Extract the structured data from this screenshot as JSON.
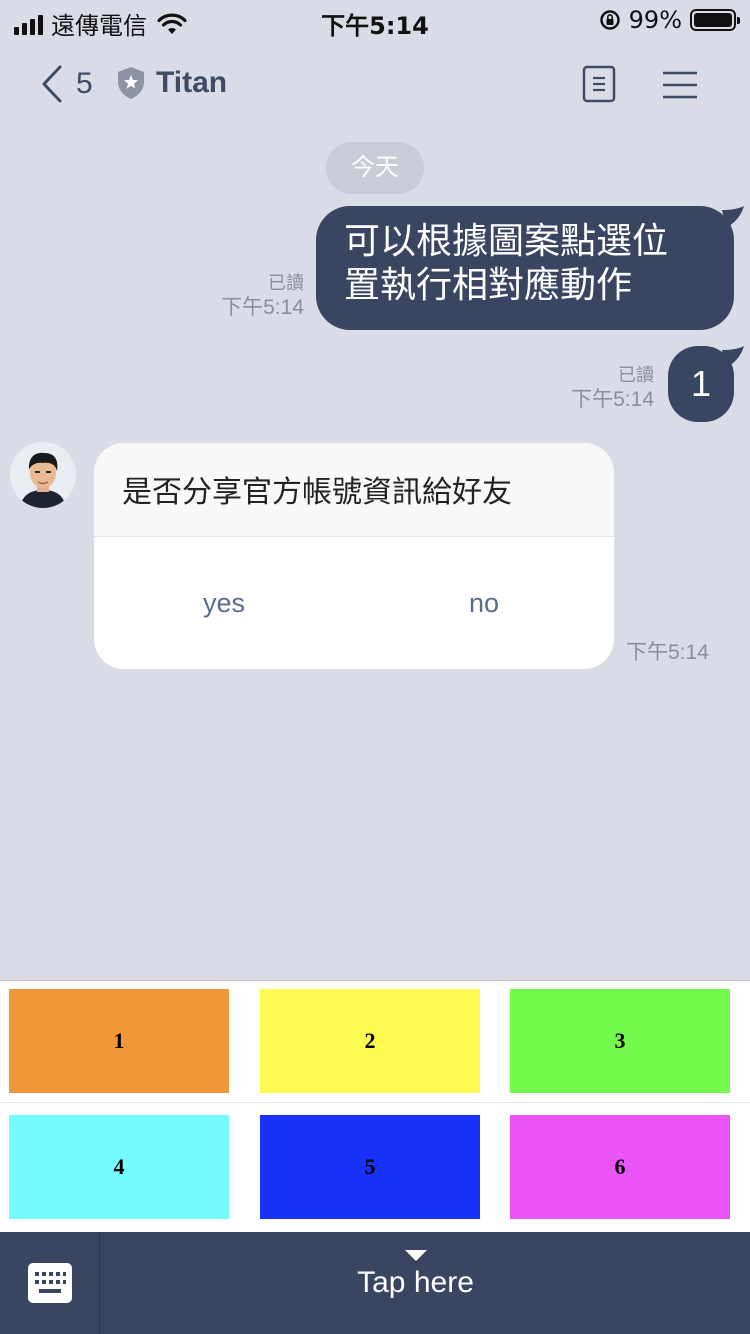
{
  "status_bar": {
    "carrier": "遠傳電信",
    "time": "下午5:14",
    "battery_percent": "99%",
    "battery_level": 0.99
  },
  "nav": {
    "unread_count": "5",
    "title": "Titan",
    "icons": [
      "chevron-left-icon",
      "shield-star-icon",
      "note-icon",
      "menu-icon"
    ]
  },
  "chat": {
    "date_label": "今天",
    "messages": [
      {
        "direction": "out",
        "text": "可以根據圖案點選位置執行相對應動作",
        "line1": "可以根據圖案點選位",
        "line2": "置執行相對應動作",
        "read_label": "已讀",
        "time": "下午5:14"
      },
      {
        "direction": "out",
        "text": "1",
        "read_label": "已讀",
        "time": "下午5:14"
      },
      {
        "direction": "in",
        "type": "confirm",
        "text": "是否分享官方帳號資訊給好友",
        "actions": [
          "yes",
          "no"
        ],
        "time": "下午5:14"
      }
    ]
  },
  "rich_menu": {
    "cells": [
      {
        "label": "1",
        "color": "#f0973a"
      },
      {
        "label": "2",
        "color": "#fdfb51"
      },
      {
        "label": "3",
        "color": "#73fa4c"
      },
      {
        "label": "4",
        "color": "#73fbfd"
      },
      {
        "label": "5",
        "color": "#1932f7"
      },
      {
        "label": "6",
        "color": "#eb54f6"
      }
    ]
  },
  "bottom_bar": {
    "tap_label": "Tap here",
    "keyboard_icon": "keyboard-icon"
  },
  "colors": {
    "background": "#d9dce6",
    "bubble": "#3a4562",
    "accent_text": "#3f4a63"
  }
}
